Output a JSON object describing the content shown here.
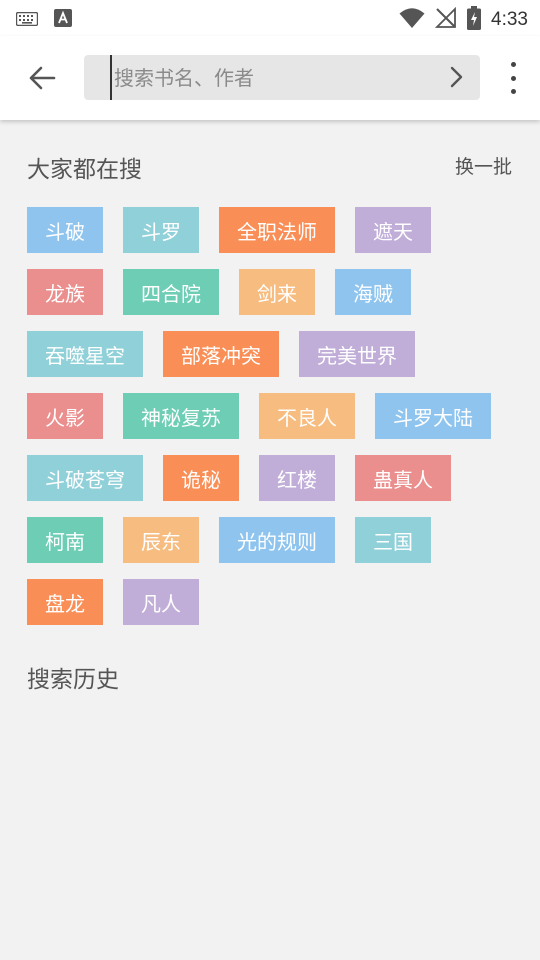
{
  "status_bar": {
    "time": "4:33"
  },
  "search": {
    "placeholder": "搜索书名、作者"
  },
  "hot": {
    "title": "大家都在搜",
    "refresh_label": "换一批",
    "rows": [
      [
        {
          "label": "斗破",
          "color": "#8ec4ee"
        },
        {
          "label": "斗罗",
          "color": "#90d0d8"
        },
        {
          "label": "全职法师",
          "color": "#f98f57"
        },
        {
          "label": "遮天",
          "color": "#c1aed8"
        }
      ],
      [
        {
          "label": "龙族",
          "color": "#ea8e8e"
        },
        {
          "label": "四合院",
          "color": "#6dcdb5"
        },
        {
          "label": "剑来",
          "color": "#f6bc80"
        },
        {
          "label": "海贼",
          "color": "#8ec4ee"
        }
      ],
      [
        {
          "label": "吞噬星空",
          "color": "#90d0d8"
        },
        {
          "label": "部落冲突",
          "color": "#f98f57"
        },
        {
          "label": "完美世界",
          "color": "#c1aed8"
        }
      ],
      [
        {
          "label": "火影",
          "color": "#ea8e8e"
        },
        {
          "label": "神秘复苏",
          "color": "#6dcdb5"
        },
        {
          "label": "不良人",
          "color": "#f6bc80"
        },
        {
          "label": "斗罗大陆",
          "color": "#8ec4ee"
        }
      ],
      [
        {
          "label": "斗破苍穹",
          "color": "#90d0d8"
        },
        {
          "label": "诡秘",
          "color": "#f98f57"
        },
        {
          "label": "红楼",
          "color": "#c1aed8"
        },
        {
          "label": "蛊真人",
          "color": "#ea8e8e"
        }
      ],
      [
        {
          "label": "柯南",
          "color": "#6dcdb5"
        },
        {
          "label": "辰东",
          "color": "#f6bc80"
        },
        {
          "label": "光的规则",
          "color": "#8ec4ee"
        },
        {
          "label": "三国",
          "color": "#90d0d8"
        }
      ],
      [
        {
          "label": "盘龙",
          "color": "#f98f57"
        },
        {
          "label": "凡人",
          "color": "#c1aed8"
        }
      ]
    ]
  },
  "history": {
    "title": "搜索历史"
  }
}
